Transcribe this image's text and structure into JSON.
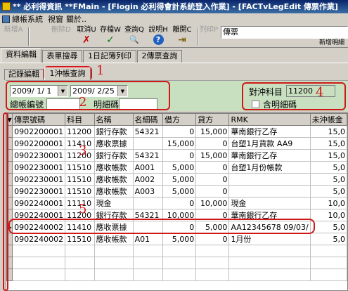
{
  "window": {
    "title": "** 必利得資訊 **FMain - [Flogin 必利得會計系統登入作業] - [FACTvLegEdit 傳票作業]"
  },
  "menu": [
    "總帳系統",
    "視窗",
    "關於.."
  ],
  "toolbar": {
    "buttons": [
      {
        "label": "新增A",
        "icon": "",
        "disabled": true
      },
      {
        "label": "刪除D",
        "icon": "",
        "disabled": true
      },
      {
        "label": "取消U",
        "icon": "✗",
        "disabled": false
      },
      {
        "label": "存檔W",
        "icon": "✓",
        "disabled": false
      },
      {
        "label": "查詢Q",
        "icon": "🔍",
        "disabled": false
      },
      {
        "label": "說明H",
        "icon": "?",
        "disabled": false
      },
      {
        "label": "離開C",
        "icon": "⇥",
        "disabled": false
      },
      {
        "label": "列印P",
        "icon": "",
        "disabled": true
      }
    ],
    "doc_type_value": "傳票",
    "new_detail_label": "新增明細"
  },
  "main_tabs": [
    "資料編輯",
    "表單搜尋",
    "1日記簿列印",
    "2傳票查詢"
  ],
  "sub_tabs": [
    "記錄編輯",
    "1沖帳查詢"
  ],
  "filter": {
    "date_from": "2009/ 1/ 1",
    "date_to": "2009/ 2/25",
    "ledger_no_label": "總帳編號",
    "ledger_no_value": "",
    "detail_code_label": "明細碼",
    "detail_code_value": "",
    "offset_account_label": "對沖科目",
    "offset_account_value": "11200",
    "include_detail_label": "含明細碼"
  },
  "annotations": [
    "1",
    "2",
    "3",
    "4",
    "5"
  ],
  "grid": {
    "columns": [
      "傳票號碼",
      "科目",
      "名稱",
      "名細碼",
      "借方",
      "貸方",
      "RMK",
      "未沖帳金"
    ],
    "rows": [
      [
        "0902200001",
        "11200",
        "銀行存款",
        "54321",
        "0",
        "15,000",
        "華南銀行乙存",
        "15,0"
      ],
      [
        "0902200001",
        "11410",
        "應收票據",
        "",
        "15,000",
        "0",
        "台塑1月貨款 AA9",
        "15,0"
      ],
      [
        "0902230001",
        "11200",
        "銀行存款",
        "54321",
        "0",
        "15,000",
        "華南銀行乙存",
        "15,0"
      ],
      [
        "0902230001",
        "11510",
        "應收帳款",
        "A001",
        "5,000",
        "0",
        "台塑1月份帳款",
        "5,0"
      ],
      [
        "0902230001",
        "11510",
        "應收帳款",
        "A002",
        "5,000",
        "0",
        "",
        "5,0"
      ],
      [
        "0902230001",
        "11510",
        "應收帳款",
        "A003",
        "5,000",
        "0",
        "",
        "5,0"
      ],
      [
        "0902240001",
        "11110",
        "現金",
        "",
        "0",
        "10,000",
        "現金",
        "10,0"
      ],
      [
        "0902240001",
        "11200",
        "銀行存款",
        "54321",
        "10,000",
        "0",
        "華南銀行乙存",
        "10,0"
      ],
      [
        "0902240002",
        "11410",
        "應收票據",
        "",
        "0",
        "5,000",
        "AA12345678 09/03/",
        "5,0"
      ],
      [
        "0902240002",
        "11510",
        "應收帳款",
        "A01",
        "5,000",
        "0",
        "1月份",
        "5,0"
      ]
    ],
    "current_row": 8
  }
}
